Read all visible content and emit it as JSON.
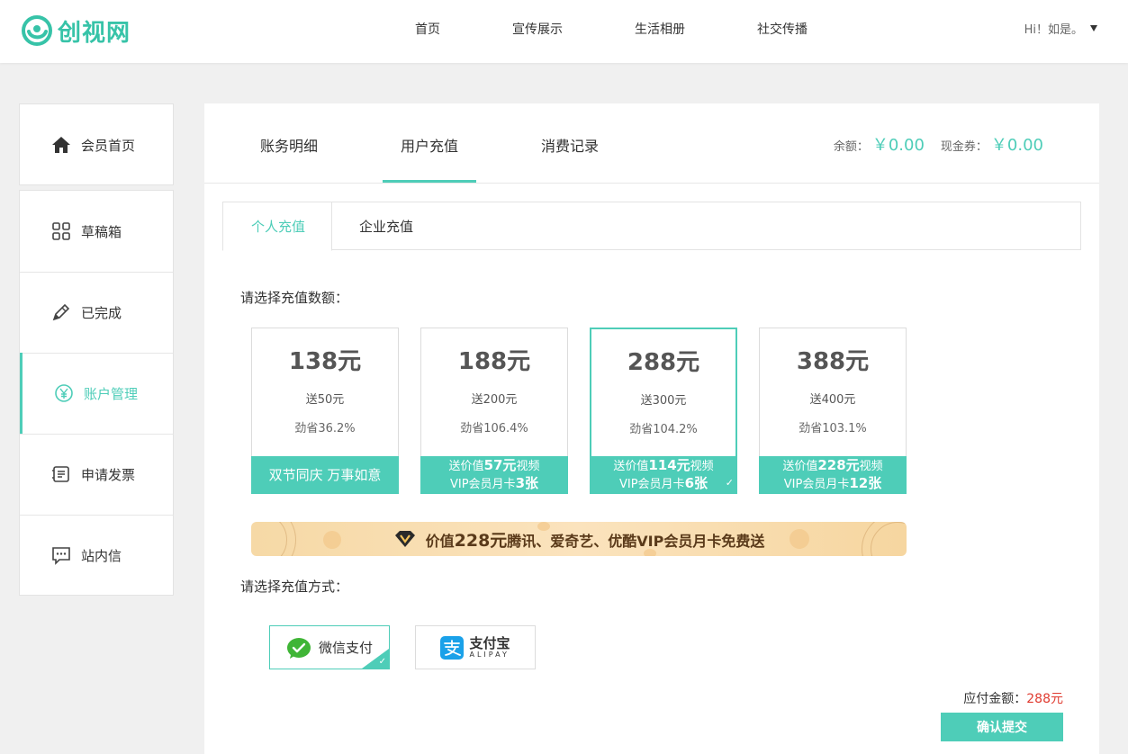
{
  "header": {
    "logo_text": "创视网",
    "nav": [
      {
        "label": "首页"
      },
      {
        "label": "宣传展示"
      },
      {
        "label": "生活相册"
      },
      {
        "label": "社交传播"
      }
    ],
    "user_greeting": "Hi！如是。"
  },
  "sidebar": {
    "items": [
      {
        "label": "会员首页",
        "icon": "home-icon"
      },
      {
        "label": "草稿箱",
        "icon": "grid-icon"
      },
      {
        "label": "已完成",
        "icon": "pencil-icon"
      },
      {
        "label": "账户管理",
        "icon": "yen-icon",
        "active": true
      },
      {
        "label": "申请发票",
        "icon": "invoice-icon"
      },
      {
        "label": "站内信",
        "icon": "message-icon"
      }
    ]
  },
  "main": {
    "tabs": [
      {
        "label": "账务明细"
      },
      {
        "label": "用户充值",
        "active": true
      },
      {
        "label": "消费记录"
      }
    ],
    "balance": {
      "label": "余额：",
      "value": "￥0.00"
    },
    "coupon": {
      "label": "现金券：",
      "value": "￥0.00"
    },
    "sub_tabs": [
      {
        "label": "个人充值",
        "active": true
      },
      {
        "label": "企业充值"
      }
    ],
    "amount_prompt": "请选择充值数额：",
    "packages": [
      {
        "amount": "138元",
        "gift": "送50元",
        "saving": "劲省36.2%",
        "band_line1": "双节同庆 万事如意"
      },
      {
        "amount": "188元",
        "gift": "送200元",
        "saving": "劲省106.4%",
        "band_pre": "送价值",
        "band_num": "57元",
        "band_post": "视频",
        "band_line2_pre": "VIP会员月卡",
        "band_line2_num": "3张"
      },
      {
        "amount": "288元",
        "gift": "送300元",
        "saving": "劲省104.2%",
        "band_pre": "送价值",
        "band_num": "114元",
        "band_post": "视频",
        "band_line2_pre": "VIP会员月卡",
        "band_line2_num": "6张",
        "selected": true
      },
      {
        "amount": "388元",
        "gift": "送400元",
        "saving": "劲省103.1%",
        "band_pre": "送价值",
        "band_num": "228元",
        "band_post": "视频",
        "band_line2_pre": "VIP会员月卡",
        "band_line2_num": "12张"
      }
    ],
    "promo": {
      "pre": "价值",
      "num": "228元",
      "post": "腾讯、爱奇艺、优酷VIP会员月卡免费送"
    },
    "method_prompt": "请选择充值方式：",
    "methods": [
      {
        "label": "微信支付",
        "selected": true
      },
      {
        "label": "支付宝",
        "sub": "ALIPAY"
      }
    ],
    "total_label": "应付金额：",
    "total_value": "288元",
    "submit_label": "确认提交"
  },
  "colors": {
    "accent": "#4ecdb8",
    "price": "#e03c31"
  }
}
